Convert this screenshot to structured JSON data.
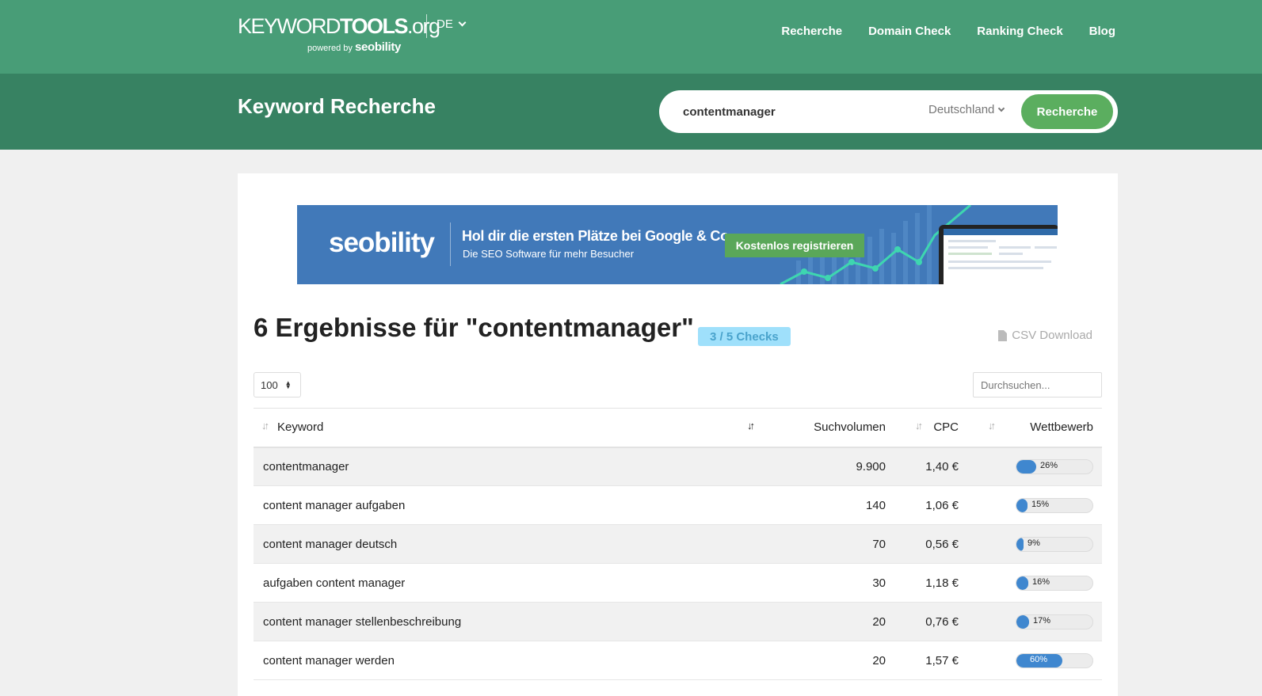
{
  "header": {
    "logo_light": "KEYWORD",
    "logo_bold": "TOOLS",
    "logo_suffix": ".org",
    "powered_by": "powered by",
    "powered_brand": "seobility",
    "lang": "DE",
    "nav": [
      "Recherche",
      "Domain Check",
      "Ranking Check",
      "Blog"
    ],
    "colors": {
      "topbar": "#489d77",
      "subbar": "#378262",
      "button": "#5bae5f"
    }
  },
  "search": {
    "title": "Keyword Recherche",
    "query": "contentmanager",
    "country": "Deutschland",
    "button": "Recherche"
  },
  "banner": {
    "logo": "seobility",
    "headline": "Hol dir die ersten Plätze bei Google & Co",
    "subline": "Die SEO Software für mehr Besucher",
    "cta": "Kostenlos registrieren"
  },
  "results": {
    "title": "6 Ergebnisse für \"contentmanager\"",
    "checks": "3 / 5 Checks",
    "csv": "CSV Download",
    "page_length": "100",
    "filter_placeholder": "Durchsuchen...",
    "columns": [
      "Keyword",
      "Suchvolumen",
      "CPC",
      "Wettbewerb"
    ],
    "rows": [
      {
        "keyword": "contentmanager",
        "volume": "9.900",
        "cpc": "1,40 €",
        "competition": 26,
        "competition_label": "26%"
      },
      {
        "keyword": "content manager aufgaben",
        "volume": "140",
        "cpc": "1,06 €",
        "competition": 15,
        "competition_label": "15%"
      },
      {
        "keyword": "content manager deutsch",
        "volume": "70",
        "cpc": "0,56 €",
        "competition": 9,
        "competition_label": "9%"
      },
      {
        "keyword": "aufgaben content manager",
        "volume": "30",
        "cpc": "1,18 €",
        "competition": 16,
        "competition_label": "16%"
      },
      {
        "keyword": "content manager stellenbeschreibung",
        "volume": "20",
        "cpc": "0,76 €",
        "competition": 17,
        "competition_label": "17%"
      },
      {
        "keyword": "content manager werden",
        "volume": "20",
        "cpc": "1,57 €",
        "competition": 60,
        "competition_label": "60%"
      }
    ]
  }
}
